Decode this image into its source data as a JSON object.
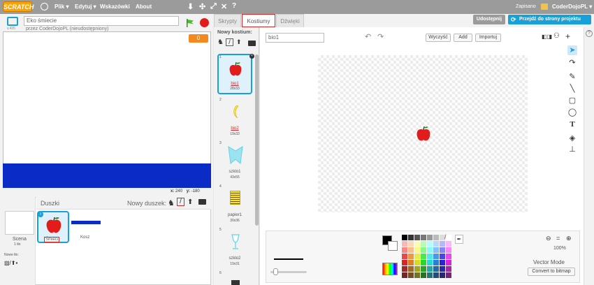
{
  "menu": {
    "logo": "SCRATCH",
    "items": [
      "Plik ▾",
      "Edytuj ▾",
      "Wskazówki",
      "About"
    ],
    "status": "Zapisano",
    "user": "CoderDojoPL ▾"
  },
  "project": {
    "title": "Eko śmiecie",
    "author": "przez CoderDojoPL (nieudostępniony)",
    "version": "v.435",
    "counter": "0",
    "coords": {
      "x_label": "x:",
      "x": "240",
      "y_label": "y:",
      "y": "-180"
    }
  },
  "sprites": {
    "header": "Duszki",
    "new_label": "Nowy duszek:",
    "stage_label": "Scena",
    "stage_sub": "1 tło",
    "new_backdrop": "Nowe tło:",
    "items": [
      {
        "name": "Śmieci",
        "selected": true
      },
      {
        "name": "Kosz",
        "selected": false
      }
    ]
  },
  "tabs": [
    "Skrypty",
    "Kostiumy",
    "Dźwięki"
  ],
  "header_buttons": {
    "share": "Udostępnij",
    "goto": "Przejdź do strony projektu"
  },
  "costumes": {
    "new_label": "Nowy kostium:",
    "items": [
      {
        "num": "1",
        "name": "bio1",
        "size": "28x33"
      },
      {
        "num": "2",
        "name": "bio2",
        "size": "19x33"
      },
      {
        "num": "3",
        "name": "szklo1",
        "size": "43x55"
      },
      {
        "num": "4",
        "name": "papier1",
        "size": "30x36"
      },
      {
        "num": "5",
        "name": "szklo2",
        "size": "19x31"
      },
      {
        "num": "6",
        "name": "",
        "size": ""
      }
    ]
  },
  "editor": {
    "name_value": "bio1",
    "clear": "Wyczyść",
    "add": "Add",
    "import": "Importuj",
    "zoom": "100%",
    "mode": "Vector Mode",
    "convert": "Convert to bitmap"
  },
  "colors": {
    "accent": "#1aa0d8",
    "orange": "#f48a1f",
    "stage_blue": "#0a2bc6",
    "apple_red": "#e21b1b",
    "banana_yellow": "#f7e33c",
    "glass_cyan": "#5fd3e8"
  }
}
